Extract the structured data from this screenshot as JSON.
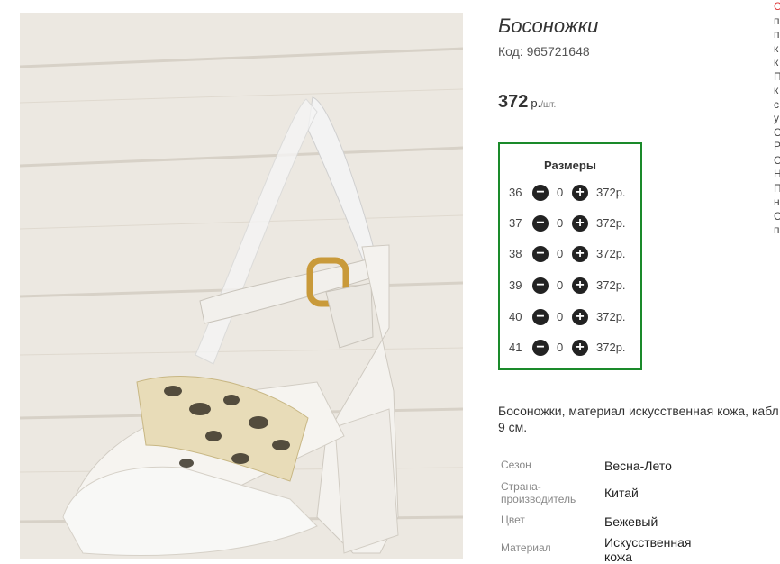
{
  "product": {
    "title": "Босоножки",
    "code_label": "Код: 965721648",
    "price_value": "372",
    "price_currency": "р.",
    "price_per": "/шт."
  },
  "sizes": {
    "title": "Размеры",
    "rows": [
      {
        "size": "36",
        "qty": "0",
        "price": "372р."
      },
      {
        "size": "37",
        "qty": "0",
        "price": "372р."
      },
      {
        "size": "38",
        "qty": "0",
        "price": "372р."
      },
      {
        "size": "39",
        "qty": "0",
        "price": "372р."
      },
      {
        "size": "40",
        "qty": "0",
        "price": "372р."
      },
      {
        "size": "41",
        "qty": "0",
        "price": "372р."
      }
    ],
    "minus_icon": "minus-circle-icon",
    "plus_icon": "plus-circle-icon",
    "border_color": "#1a8a2a"
  },
  "description": {
    "line1": "Босоножки, материал искусственная кожа, кабл",
    "line2": "9 см."
  },
  "properties": [
    {
      "key": "Сезон",
      "value": "Весна-Лето"
    },
    {
      "key": "Страна-производитель",
      "value": "Китай"
    },
    {
      "key": "Цвет",
      "value": "Бежевый"
    },
    {
      "key": "Материал",
      "value": "Искусственная кожа"
    }
  ],
  "side_text": [
    "С",
    "п",
    "п",
    "к",
    "к",
    "П",
    "к",
    "с",
    "у",
    "С",
    "Р",
    "С",
    "Н",
    "П",
    "н",
    "С",
    "п"
  ]
}
